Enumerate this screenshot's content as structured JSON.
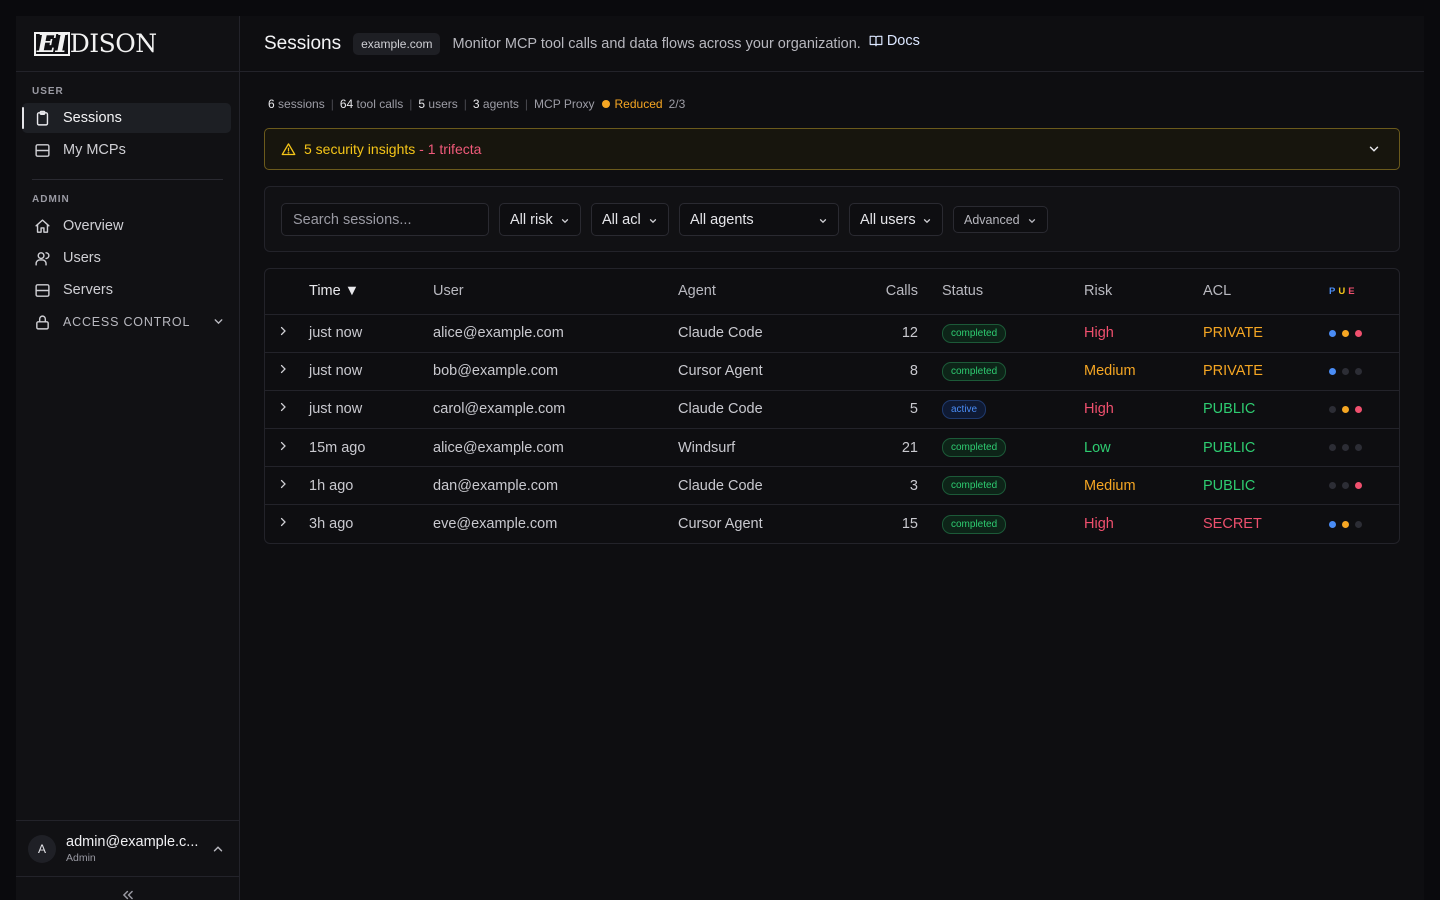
{
  "brand": {
    "logo_boxed": "EI",
    "logo_rest": "DISON"
  },
  "sidebar": {
    "user_section": "USER",
    "user_items": [
      {
        "label": "Sessions",
        "icon": "clipboard-icon"
      },
      {
        "label": "My MCPs",
        "icon": "server-icon"
      }
    ],
    "admin_section": "ADMIN",
    "admin_items": [
      {
        "label": "Overview",
        "icon": "home-icon"
      },
      {
        "label": "Users",
        "icon": "users-icon"
      },
      {
        "label": "Servers",
        "icon": "server-icon"
      }
    ],
    "access_control": "ACCESS CONTROL",
    "account": {
      "avatar": "A",
      "email": "admin@example.c...",
      "role": "Admin"
    }
  },
  "header": {
    "title": "Sessions",
    "domain": "example.com",
    "subtitle": "Monitor MCP tool calls and data flows across your organization.",
    "docs": "Docs"
  },
  "stats": {
    "sessions_count": "6",
    "sessions_label": "sessions",
    "tool_calls_count": "64",
    "tool_calls_label": "tool calls",
    "users_count": "5",
    "users_label": "users",
    "agents_count": "3",
    "agents_label": "agents",
    "proxy": "MCP Proxy",
    "proxy_state": "Reduced",
    "proxy_ratio": "2/3",
    "proxy_color": "#f5a623"
  },
  "insights": {
    "text": "5 security insights",
    "trifecta": " - 1 trifecta"
  },
  "filters": {
    "search_placeholder": "Search sessions...",
    "risk": "All risk",
    "acl": "All acl",
    "agents": "All agents",
    "users": "All users",
    "advanced": "Advanced"
  },
  "table": {
    "headers": {
      "time": "Time ▼",
      "user": "User",
      "agent": "Agent",
      "calls": "Calls",
      "status": "Status",
      "risk": "Risk",
      "acl": "ACL",
      "pue_p": "P",
      "pue_u": "U",
      "pue_e": "E"
    },
    "rows": [
      {
        "time": "just now",
        "user": "alice@example.com",
        "agent": "Claude Code",
        "calls": "12",
        "status": "completed",
        "risk": "High",
        "acl": "PRIVATE",
        "dots": [
          "#4a8cf5",
          "#f5a623",
          "#f0506e"
        ]
      },
      {
        "time": "just now",
        "user": "bob@example.com",
        "agent": "Cursor Agent",
        "calls": "8",
        "status": "completed",
        "risk": "Medium",
        "acl": "PRIVATE",
        "dots": [
          "#4a8cf5",
          "#2c2d35",
          "#2c2d35"
        ]
      },
      {
        "time": "just now",
        "user": "carol@example.com",
        "agent": "Claude Code",
        "calls": "5",
        "status": "active",
        "risk": "High",
        "acl": "PUBLIC",
        "dots": [
          "#2c2d35",
          "#f5a623",
          "#f0506e"
        ]
      },
      {
        "time": "15m ago",
        "user": "alice@example.com",
        "agent": "Windsurf",
        "calls": "21",
        "status": "completed",
        "risk": "Low",
        "acl": "PUBLIC",
        "dots": [
          "#2c2d35",
          "#2c2d35",
          "#2c2d35"
        ]
      },
      {
        "time": "1h ago",
        "user": "dan@example.com",
        "agent": "Claude Code",
        "calls": "3",
        "status": "completed",
        "risk": "Medium",
        "acl": "PUBLIC",
        "dots": [
          "#2c2d35",
          "#2c2d35",
          "#f0506e"
        ]
      },
      {
        "time": "3h ago",
        "user": "eve@example.com",
        "agent": "Cursor Agent",
        "calls": "15",
        "status": "completed",
        "risk": "High",
        "acl": "SECRET",
        "dots": [
          "#4a8cf5",
          "#f5a623",
          "#2c2d35"
        ]
      }
    ]
  },
  "colors": {
    "risk": {
      "High": "#f0506e",
      "Medium": "#f5a623",
      "Low": "#2ecc71"
    },
    "acl": {
      "PRIVATE": "#f5a623",
      "PUBLIC": "#2ecc71",
      "SECRET": "#f0506e"
    },
    "status": {
      "completed": "#2ecc71",
      "active": "#4a8cf5"
    },
    "pue": {
      "P": "#4a8cf5",
      "U": "#f5c518",
      "E": "#f0506e"
    }
  }
}
